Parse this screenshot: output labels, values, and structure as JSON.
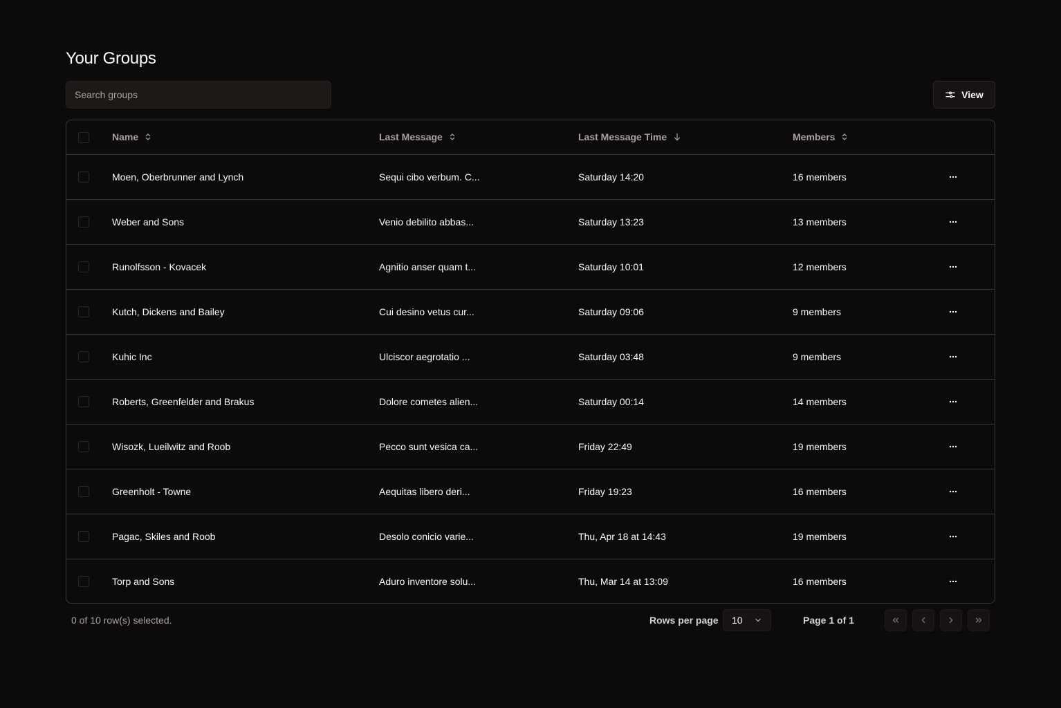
{
  "header": {
    "title": "Your Groups"
  },
  "toolbar": {
    "search_placeholder": "Search groups",
    "search_value": "",
    "view_label": "View",
    "view_icon": "sliders-icon"
  },
  "table": {
    "columns": [
      {
        "key": "select",
        "label": ""
      },
      {
        "key": "name",
        "label": "Name",
        "sort_icon": "chevrons-up-down-icon",
        "sorted": null
      },
      {
        "key": "last_message",
        "label": "Last Message",
        "sort_icon": "chevrons-up-down-icon",
        "sorted": null
      },
      {
        "key": "last_message_time",
        "label": "Last Message Time",
        "sort_icon": "arrow-down-icon",
        "sorted": "desc"
      },
      {
        "key": "members",
        "label": "Members",
        "sort_icon": "chevrons-up-down-icon",
        "sorted": null
      },
      {
        "key": "actions",
        "label": ""
      }
    ],
    "rows": [
      {
        "name": "Moen, Oberbrunner and Lynch",
        "last_message": "Sequi cibo verbum. C...",
        "last_message_time": "Saturday 14:20",
        "members": "16 members",
        "selected": false
      },
      {
        "name": "Weber and Sons",
        "last_message": "Venio debilito abbas...",
        "last_message_time": "Saturday 13:23",
        "members": "13 members",
        "selected": false
      },
      {
        "name": "Runolfsson - Kovacek",
        "last_message": "Agnitio anser quam t...",
        "last_message_time": "Saturday 10:01",
        "members": "12 members",
        "selected": false
      },
      {
        "name": "Kutch, Dickens and Bailey",
        "last_message": "Cui desino vetus cur...",
        "last_message_time": "Saturday 09:06",
        "members": "9 members",
        "selected": false
      },
      {
        "name": "Kuhic Inc",
        "last_message": "Ulciscor aegrotatio ...",
        "last_message_time": "Saturday 03:48",
        "members": "9 members",
        "selected": false
      },
      {
        "name": "Roberts, Greenfelder and Brakus",
        "last_message": "Dolore cometes alien...",
        "last_message_time": "Saturday 00:14",
        "members": "14 members",
        "selected": false
      },
      {
        "name": "Wisozk, Lueilwitz and Roob",
        "last_message": "Pecco sunt vesica ca...",
        "last_message_time": "Friday 22:49",
        "members": "19 members",
        "selected": false
      },
      {
        "name": "Greenholt - Towne",
        "last_message": "Aequitas libero deri...",
        "last_message_time": "Friday 19:23",
        "members": "16 members",
        "selected": false
      },
      {
        "name": "Pagac, Skiles and Roob",
        "last_message": "Desolo conicio varie...",
        "last_message_time": "Thu, Apr 18 at 14:43",
        "members": "19 members",
        "selected": false
      },
      {
        "name": "Torp and Sons",
        "last_message": "Aduro inventore solu...",
        "last_message_time": "Thu, Mar 14 at 13:09",
        "members": "16 members",
        "selected": false
      }
    ]
  },
  "footer": {
    "selection_text": "0 of 10 row(s) selected.",
    "rows_per_page_label": "Rows per page",
    "rows_per_page_value": "10",
    "page_info": "Page 1 of 1",
    "pager_buttons": [
      "first-page",
      "previous-page",
      "next-page",
      "last-page"
    ]
  }
}
